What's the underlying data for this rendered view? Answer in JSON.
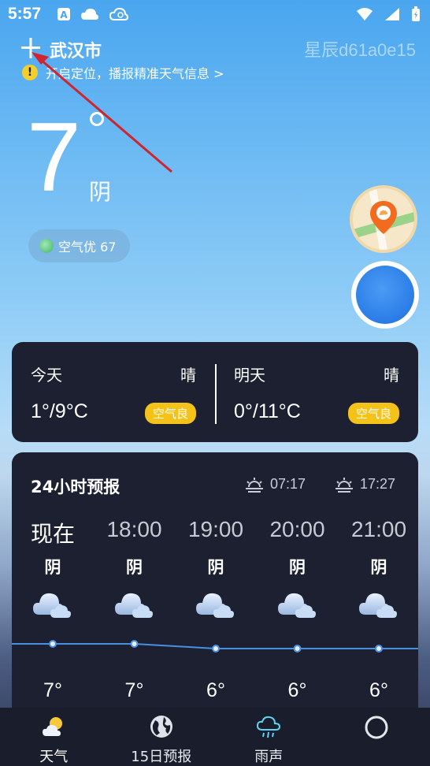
{
  "status_bar": {
    "time": "5:57"
  },
  "header": {
    "city": "武汉市",
    "watermark": "星辰d61a0e15",
    "location_hint": "开启定位，播报精准天气信息 >"
  },
  "current": {
    "temp": "7",
    "condition": "阴",
    "aqi_label": "空气优 67"
  },
  "days": [
    {
      "label": "今天",
      "condition": "晴",
      "temp_range": "1°/9°C",
      "aqi": "空气良"
    },
    {
      "label": "明天",
      "condition": "晴",
      "temp_range": "0°/11°C",
      "aqi": "空气良"
    }
  ],
  "hourly": {
    "title": "24小时预报",
    "sunrise": "07:17",
    "sunset": "17:27",
    "hours": [
      {
        "time": "现在",
        "condition": "阴",
        "temp": "7°",
        "temp_value": 7
      },
      {
        "time": "18:00",
        "condition": "阴",
        "temp": "7°",
        "temp_value": 7
      },
      {
        "time": "19:00",
        "condition": "阴",
        "temp": "6°",
        "temp_value": 6
      },
      {
        "time": "20:00",
        "condition": "阴",
        "temp": "6°",
        "temp_value": 6
      },
      {
        "time": "21:00",
        "condition": "阴",
        "temp": "6°",
        "temp_value": 6
      }
    ]
  },
  "nav": [
    {
      "label": "天气",
      "icon": "partly-cloudy-icon",
      "active": true
    },
    {
      "label": "15日预报",
      "icon": "globe-icon",
      "active": false
    },
    {
      "label": "雨声",
      "icon": "rain-cloud-icon",
      "active": false
    },
    {
      "label": "",
      "icon": "ring-icon",
      "active": false
    }
  ],
  "colors": {
    "card_bg": "#1c2030",
    "aqi_badge": "#f5c21a",
    "annotation_arrow": "#d0242f",
    "line": "#4a90e2"
  }
}
